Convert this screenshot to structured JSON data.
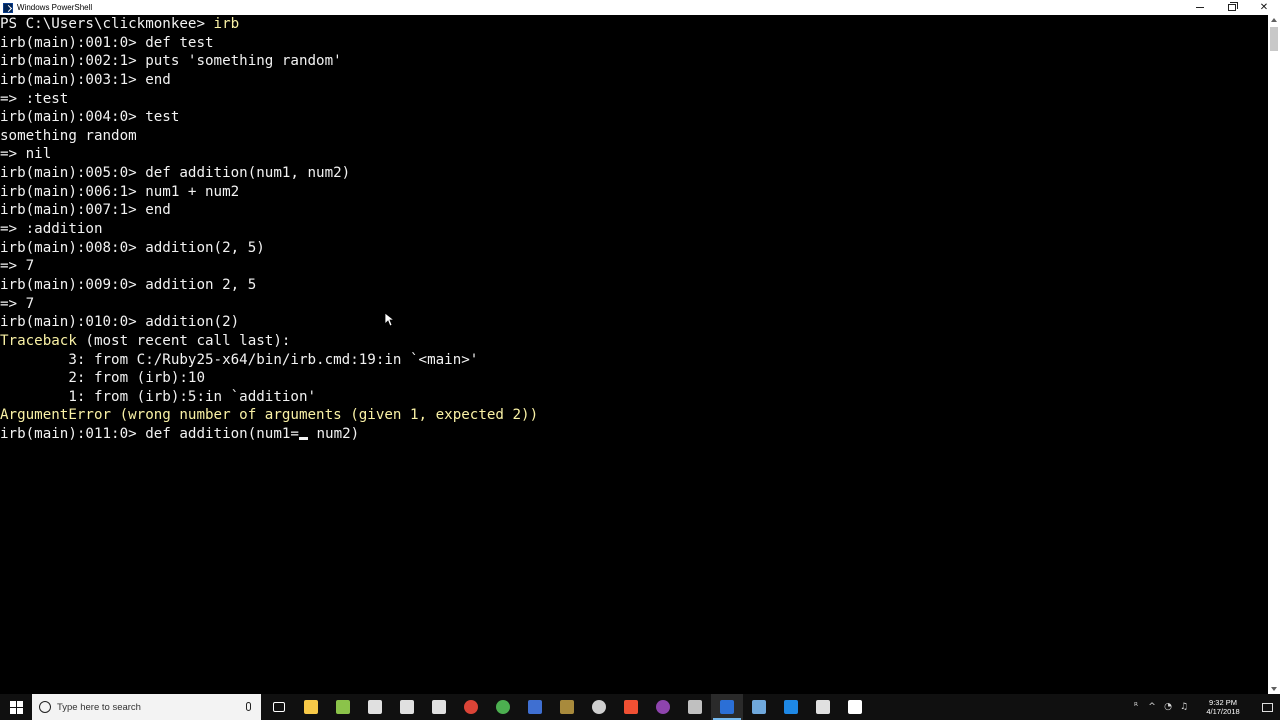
{
  "window": {
    "title": "Windows PowerShell",
    "minimize_label": "",
    "maximize_label": "",
    "close_label": "✕"
  },
  "console": {
    "lines": [
      "PS C:\\Users\\clickmonkee> irb",
      "irb(main):001:0> def test",
      "irb(main):002:1> puts 'something random'",
      "irb(main):003:1> end",
      "=> :test",
      "irb(main):004:0> test",
      "something random",
      "=> nil",
      "irb(main):005:0> def addition(num1, num2)",
      "irb(main):006:1> num1 + num2",
      "irb(main):007:1> end",
      "=> :addition",
      "irb(main):008:0> addition(2, 5)",
      "=> 7",
      "irb(main):009:0> addition 2, 5",
      "=> 7",
      "irb(main):010:0> addition(2)",
      "Traceback (most recent call last):",
      "        3: from C:/Ruby25-x64/bin/irb.cmd:19:in `<main>'",
      "        2: from (irb):10",
      "        1: from (irb):5:in `addition'",
      "ArgumentError (wrong number of arguments (given 1, expected 2))",
      "irb(main):011:0> def addition(num1="
    ],
    "line0_prefix": "PS C:\\Users\\clickmonkee> ",
    "line0_command": "irb",
    "traceback_word": "Traceback",
    "traceback_rest": " (most recent call last):",
    "current_input_before_caret": "irb(main):011:0> def addition(num1=",
    "current_input_after_caret": " num2)",
    "colors": {
      "background": "#000000",
      "foreground": "#f2f2f2",
      "highlight": "#f9f1a5"
    }
  },
  "taskbar": {
    "search_placeholder": "Type here to search",
    "clock_time": "9:32 PM",
    "clock_date": "4/17/2018",
    "apps": [
      {
        "name": "task-view-icon",
        "color": "#ffffff"
      },
      {
        "name": "file-explorer-icon",
        "color": "#f7c948"
      },
      {
        "name": "notepad-plus-icon",
        "color": "#8bc34a"
      },
      {
        "name": "calculator-icon",
        "color": "#e0e0e0"
      },
      {
        "name": "store-icon",
        "color": "#e0e0e0"
      },
      {
        "name": "mail-icon",
        "color": "#e0e0e0"
      },
      {
        "name": "chrome-icon",
        "color": "#db4437"
      },
      {
        "name": "xbox-icon",
        "color": "#4caf50"
      },
      {
        "name": "app-blue-icon",
        "color": "#3f6fd1"
      },
      {
        "name": "gimp-icon",
        "color": "#a88a3c"
      },
      {
        "name": "obs-icon",
        "color": "#cfcfcf"
      },
      {
        "name": "git-icon",
        "color": "#f05033"
      },
      {
        "name": "circle-app-icon",
        "color": "#8e44ad"
      },
      {
        "name": "cmd-icon",
        "color": "#c0c0c0"
      },
      {
        "name": "powershell-icon",
        "color": "#2b6fd6"
      },
      {
        "name": "thunderbird-icon",
        "color": "#6fa8dc"
      },
      {
        "name": "vscode-icon",
        "color": "#1e88e5"
      },
      {
        "name": "window-app-icon",
        "color": "#e0e0e0"
      },
      {
        "name": "video-editor-icon",
        "color": "#ffffff"
      }
    ],
    "tray": [
      "people-icon",
      "chevron-up-icon",
      "network-icon",
      "volume-icon"
    ]
  }
}
